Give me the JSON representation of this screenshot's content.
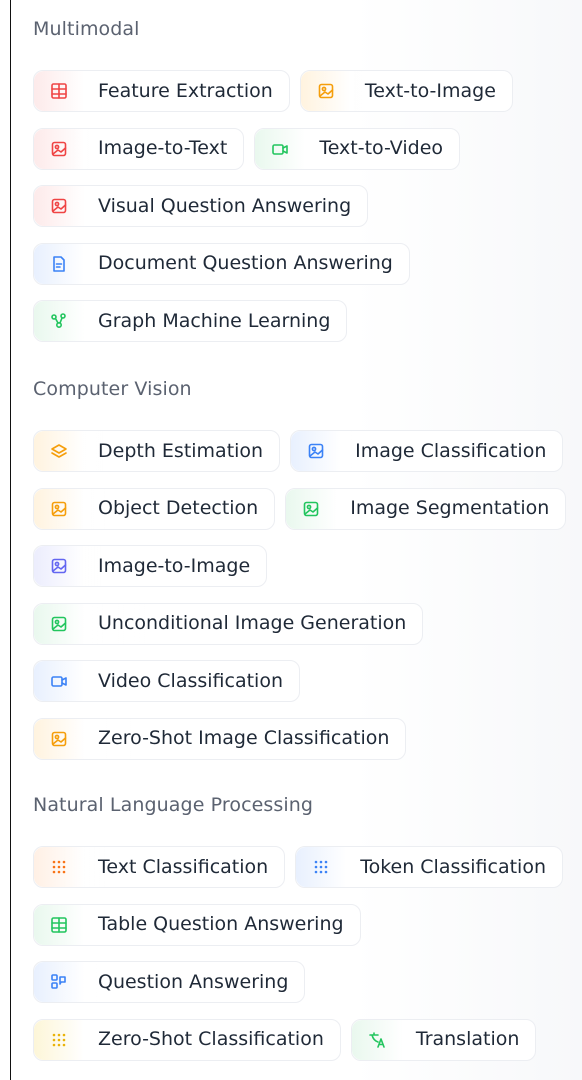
{
  "sections": [
    {
      "title": "Multimodal",
      "rows": [
        [
          {
            "label": "Feature Extraction",
            "icon": "grid-table-icon",
            "color": "#ef4444"
          },
          {
            "label": "Text-to-Image",
            "icon": "image-pen-icon",
            "color": "#f59e0b"
          }
        ],
        [
          {
            "label": "Image-to-Text",
            "icon": "image-edit-icon",
            "color": "#ef4444"
          },
          {
            "label": "Text-to-Video",
            "icon": "video-icon",
            "color": "#22c55e"
          }
        ],
        [
          {
            "label": "Visual Question Answering",
            "icon": "frame-icon",
            "color": "#ef4444"
          }
        ],
        [
          {
            "label": "Document Question Answering",
            "icon": "document-icon",
            "color": "#3b82f6"
          }
        ],
        [
          {
            "label": "Graph Machine Learning",
            "icon": "graph-icon",
            "color": "#22c55e"
          }
        ]
      ]
    },
    {
      "title": "Computer Vision",
      "rows": [
        [
          {
            "label": "Depth Estimation",
            "icon": "layers-icon",
            "color": "#f59e0b"
          },
          {
            "label": "Image Classification",
            "icon": "image-tag-icon",
            "color": "#3b82f6"
          }
        ],
        [
          {
            "label": "Object Detection",
            "icon": "detect-icon",
            "color": "#f59e0b"
          },
          {
            "label": "Image Segmentation",
            "icon": "segment-icon",
            "color": "#22c55e"
          }
        ],
        [
          {
            "label": "Image-to-Image",
            "icon": "image-icon",
            "color": "#6366f1"
          }
        ],
        [
          {
            "label": "Unconditional Image Generation",
            "icon": "image-plus-icon",
            "color": "#22c55e"
          }
        ],
        [
          {
            "label": "Video Classification",
            "icon": "video-tag-icon",
            "color": "#3b82f6"
          }
        ],
        [
          {
            "label": "Zero-Shot Image Classification",
            "icon": "zero-shot-image-icon",
            "color": "#f59e0b"
          }
        ]
      ]
    },
    {
      "title": "Natural Language Processing",
      "rows": [
        [
          {
            "label": "Text Classification",
            "icon": "dots-text-icon",
            "color": "#f97316"
          },
          {
            "label": "Token Classification",
            "icon": "token-icon",
            "color": "#3b82f6"
          }
        ],
        [
          {
            "label": "Table Question Answering",
            "icon": "table-icon",
            "color": "#22c55e"
          }
        ],
        [
          {
            "label": "Question Answering",
            "icon": "qa-icon",
            "color": "#3b82f6"
          }
        ],
        [
          {
            "label": "Zero-Shot Classification",
            "icon": "sparkle-grid-icon",
            "color": "#eab308"
          },
          {
            "label": "Translation",
            "icon": "translate-icon",
            "color": "#22c55e"
          }
        ]
      ]
    }
  ]
}
